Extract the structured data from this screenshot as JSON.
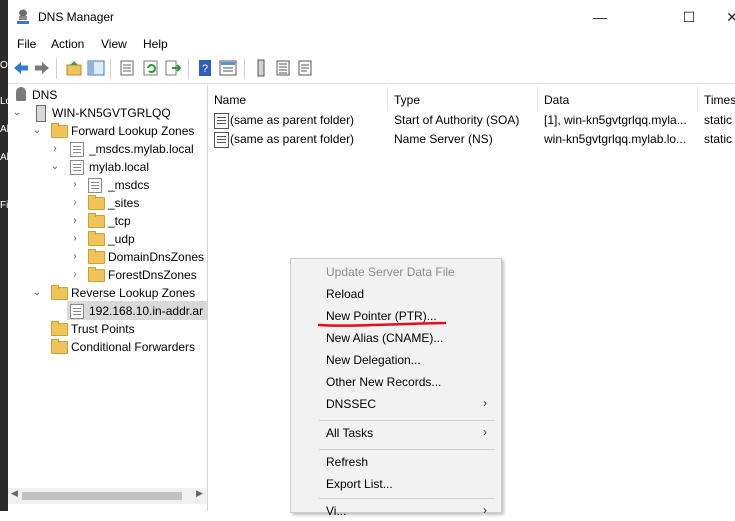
{
  "window": {
    "title": "DNS Manager",
    "controls": {
      "minimize": "—",
      "maximize": "☐",
      "close": "✕"
    }
  },
  "menubar": [
    "File",
    "Action",
    "View",
    "Help"
  ],
  "toolbar_icons": [
    "back-icon",
    "forward-icon",
    "up-folder-icon",
    "show-hide-tree-icon",
    "properties-icon",
    "refresh-icon",
    "export-list-icon",
    "help-icon",
    "details-view-icon",
    "server-record-icon",
    "list-icon",
    "filter-icon"
  ],
  "tree": {
    "items": [
      {
        "label": "DNS",
        "icon": "dns-icon",
        "chevron": ""
      },
      {
        "label": "WIN-KN5GVTGRLQQ",
        "icon": "server-icon",
        "chevron": "⌄"
      },
      {
        "label": "Forward Lookup Zones",
        "icon": "folder-icon",
        "chevron": "⌄"
      },
      {
        "label": "_msdcs.mylab.local",
        "icon": "zone-icon",
        "chevron": "›"
      },
      {
        "label": "mylab.local",
        "icon": "zone-icon",
        "chevron": "⌄"
      },
      {
        "label": "_msdcs",
        "icon": "zone-icon",
        "chevron": "›"
      },
      {
        "label": "_sites",
        "icon": "folder-icon",
        "chevron": "›"
      },
      {
        "label": "_tcp",
        "icon": "folder-icon",
        "chevron": "›"
      },
      {
        "label": "_udp",
        "icon": "folder-icon",
        "chevron": "›"
      },
      {
        "label": "DomainDnsZones",
        "icon": "folder-icon",
        "chevron": "›"
      },
      {
        "label": "ForestDnsZones",
        "icon": "folder-icon",
        "chevron": "›"
      },
      {
        "label": "Reverse Lookup Zones",
        "icon": "folder-icon",
        "chevron": "⌄"
      },
      {
        "label": "192.168.10.in-addr.ar",
        "icon": "zone-icon",
        "chevron": ""
      },
      {
        "label": "Trust Points",
        "icon": "folder-icon",
        "chevron": ""
      },
      {
        "label": "Conditional Forwarders",
        "icon": "folder-icon",
        "chevron": ""
      }
    ]
  },
  "records": {
    "columns": [
      "Name",
      "Type",
      "Data",
      "Times"
    ],
    "rows": [
      {
        "name": "(same as parent folder)",
        "type": "Start of Authority (SOA)",
        "data": "[1], win-kn5gvtgrlqq.myla...",
        "timestamp": "static"
      },
      {
        "name": "(same as parent folder)",
        "type": "Name Server (NS)",
        "data": "win-kn5gvtgrlqq.mylab.lo...",
        "timestamp": "static"
      }
    ]
  },
  "context_menu": {
    "items": [
      {
        "label": "Update Server Data File",
        "enabled": false
      },
      {
        "label": "Reload",
        "enabled": true
      },
      {
        "label": "New Pointer (PTR)...",
        "enabled": true,
        "highlighted_annotation": true
      },
      {
        "label": "New Alias (CNAME)...",
        "enabled": true
      },
      {
        "label": "New Delegation...",
        "enabled": true
      },
      {
        "label": "Other New Records...",
        "enabled": true
      },
      {
        "label": "DNSSEC",
        "enabled": true,
        "submenu": true
      },
      {
        "label": "All Tasks",
        "enabled": true,
        "submenu": true
      },
      {
        "label": "Refresh",
        "enabled": true
      },
      {
        "label": "Export List...",
        "enabled": true
      },
      {
        "label": "Vi...",
        "enabled": true
      }
    ],
    "submenu_arrow": "›"
  },
  "annotation_color": "#e0101a",
  "desktop_strip_glyphs": [
    "O",
    "Lo",
    "Al",
    "Al",
    "Fi"
  ]
}
